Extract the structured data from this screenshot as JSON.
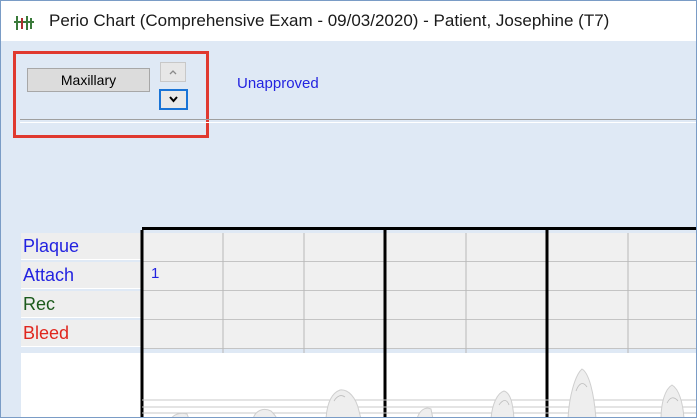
{
  "window": {
    "title": "Perio Chart (Comprehensive Exam - 09/03/2020) - Patient, Josephine (T7)",
    "app_icon": "perio-chart-icon"
  },
  "toolbar": {
    "arch_label": "Maxillary",
    "up_icon": "chevron-up-icon",
    "down_icon": "chevron-down-icon",
    "status": "Unapproved"
  },
  "chart": {
    "rows": [
      {
        "label": "Plaque",
        "color": "#2323e0"
      },
      {
        "label": "Attach",
        "color": "#2323e0"
      },
      {
        "label": "Rec",
        "color": "#1c5a1c"
      },
      {
        "label": "Bleed",
        "color": "#e0261d"
      }
    ],
    "values": {
      "attach_first": "1"
    }
  },
  "colors": {
    "highlight": "#e0392f",
    "focus": "#1a74d6",
    "window_bg": "#dfe9f5"
  }
}
